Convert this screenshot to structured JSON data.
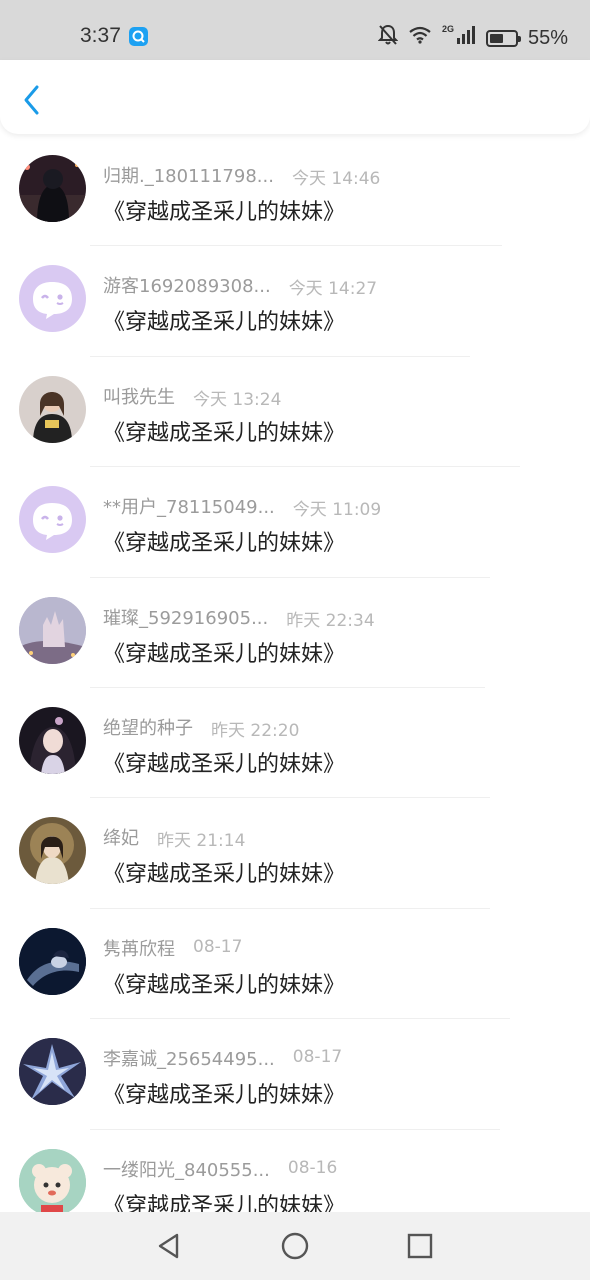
{
  "status_bar": {
    "time": "3:37",
    "network": "2G",
    "battery": "55%",
    "battery_level": 0.55,
    "icons": [
      "search-app-icon",
      "bell-off-icon",
      "wifi-icon",
      "signal-icon",
      "battery-icon"
    ]
  },
  "header": {
    "back_icon": "chevron-left-icon",
    "accent_color": "#1a9be8"
  },
  "list": {
    "items": [
      {
        "name": "归期._180111798...",
        "time": "今天 14:46",
        "title": "《穿越成圣采儿的妹妹》",
        "avatar": "photo-night-avatar"
      },
      {
        "name": "游客1692089308...",
        "time": "今天 14:27",
        "title": "《穿越成圣采儿的妹妹》",
        "avatar": "default-purple-avatar"
      },
      {
        "name": "叫我先生",
        "time": "今天 13:24",
        "title": "《穿越成圣采儿的妹妹》",
        "avatar": "photo-girl-avatar"
      },
      {
        "name": "**用户_78115049...",
        "time": "今天 11:09",
        "title": "《穿越成圣采儿的妹妹》",
        "avatar": "default-purple-avatar"
      },
      {
        "name": "璀璨_592916905...",
        "time": "昨天 22:34",
        "title": "《穿越成圣采儿的妹妹》",
        "avatar": "photo-castle-avatar"
      },
      {
        "name": "绝望的种子",
        "time": "昨天 22:20",
        "title": "《穿越成圣采儿的妹妹》",
        "avatar": "photo-anime-girl-avatar"
      },
      {
        "name": "绛妃",
        "time": "昨天 21:14",
        "title": "《穿越成圣采儿的妹妹》",
        "avatar": "photo-painted-girl-avatar"
      },
      {
        "name": "隽苒欣程",
        "time": "08-17",
        "title": "《穿越成圣采儿的妹妹》",
        "avatar": "photo-dark-blue-avatar"
      },
      {
        "name": "李嘉诚_25654495...",
        "time": "08-17",
        "title": "《穿越成圣采儿的妹妹》",
        "avatar": "photo-crystal-avatar"
      },
      {
        "name": "一缕阳光_840555...",
        "time": "08-16",
        "title": "《穿越成圣采儿的妹妹》",
        "avatar": "photo-cartoon-avatar"
      }
    ]
  },
  "nav_bar": {
    "icons": [
      "back-triangle-icon",
      "home-circle-icon",
      "recents-square-icon"
    ]
  }
}
